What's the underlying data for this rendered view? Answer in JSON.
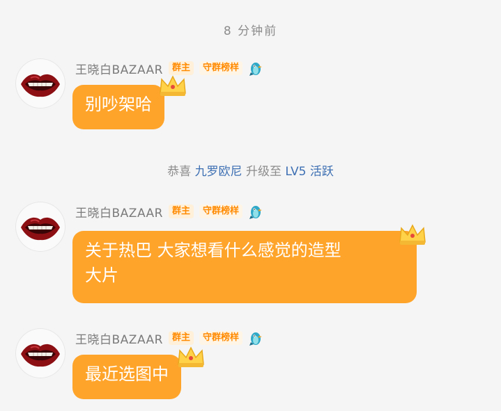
{
  "timestamp": "8 分钟前",
  "system_notice": {
    "prefix": "恭喜",
    "user": "九罗欧尼",
    "middle": "升级至",
    "level": "LV5 活跃"
  },
  "messages": [
    {
      "sender": "王晓白BAZAAR",
      "badge_owner": "群主",
      "badge_guard": "守群榜样",
      "avatar": "red-lips-avatar",
      "bird_icon": "blue-bird-icon",
      "crown_icon": "gold-crown-icon",
      "text": "别吵架哈"
    },
    {
      "sender": "王晓白BAZAAR",
      "badge_owner": "群主",
      "badge_guard": "守群榜样",
      "avatar": "red-lips-avatar",
      "bird_icon": "blue-bird-icon",
      "crown_icon": "gold-crown-icon",
      "text_line1": "关于热巴 大家想看什么感觉的造型",
      "text_line2": "大片"
    },
    {
      "sender": "王晓白BAZAAR",
      "badge_owner": "群主",
      "badge_guard": "守群榜样",
      "avatar": "red-lips-avatar",
      "bird_icon": "blue-bird-icon",
      "crown_icon": "gold-crown-icon",
      "text": "最近选图中"
    }
  ],
  "colors": {
    "bubble": "#ffa42a",
    "badge_text": "#ff8a00",
    "system_highlight": "#3d6fb3",
    "background": "#f5f5f5"
  }
}
